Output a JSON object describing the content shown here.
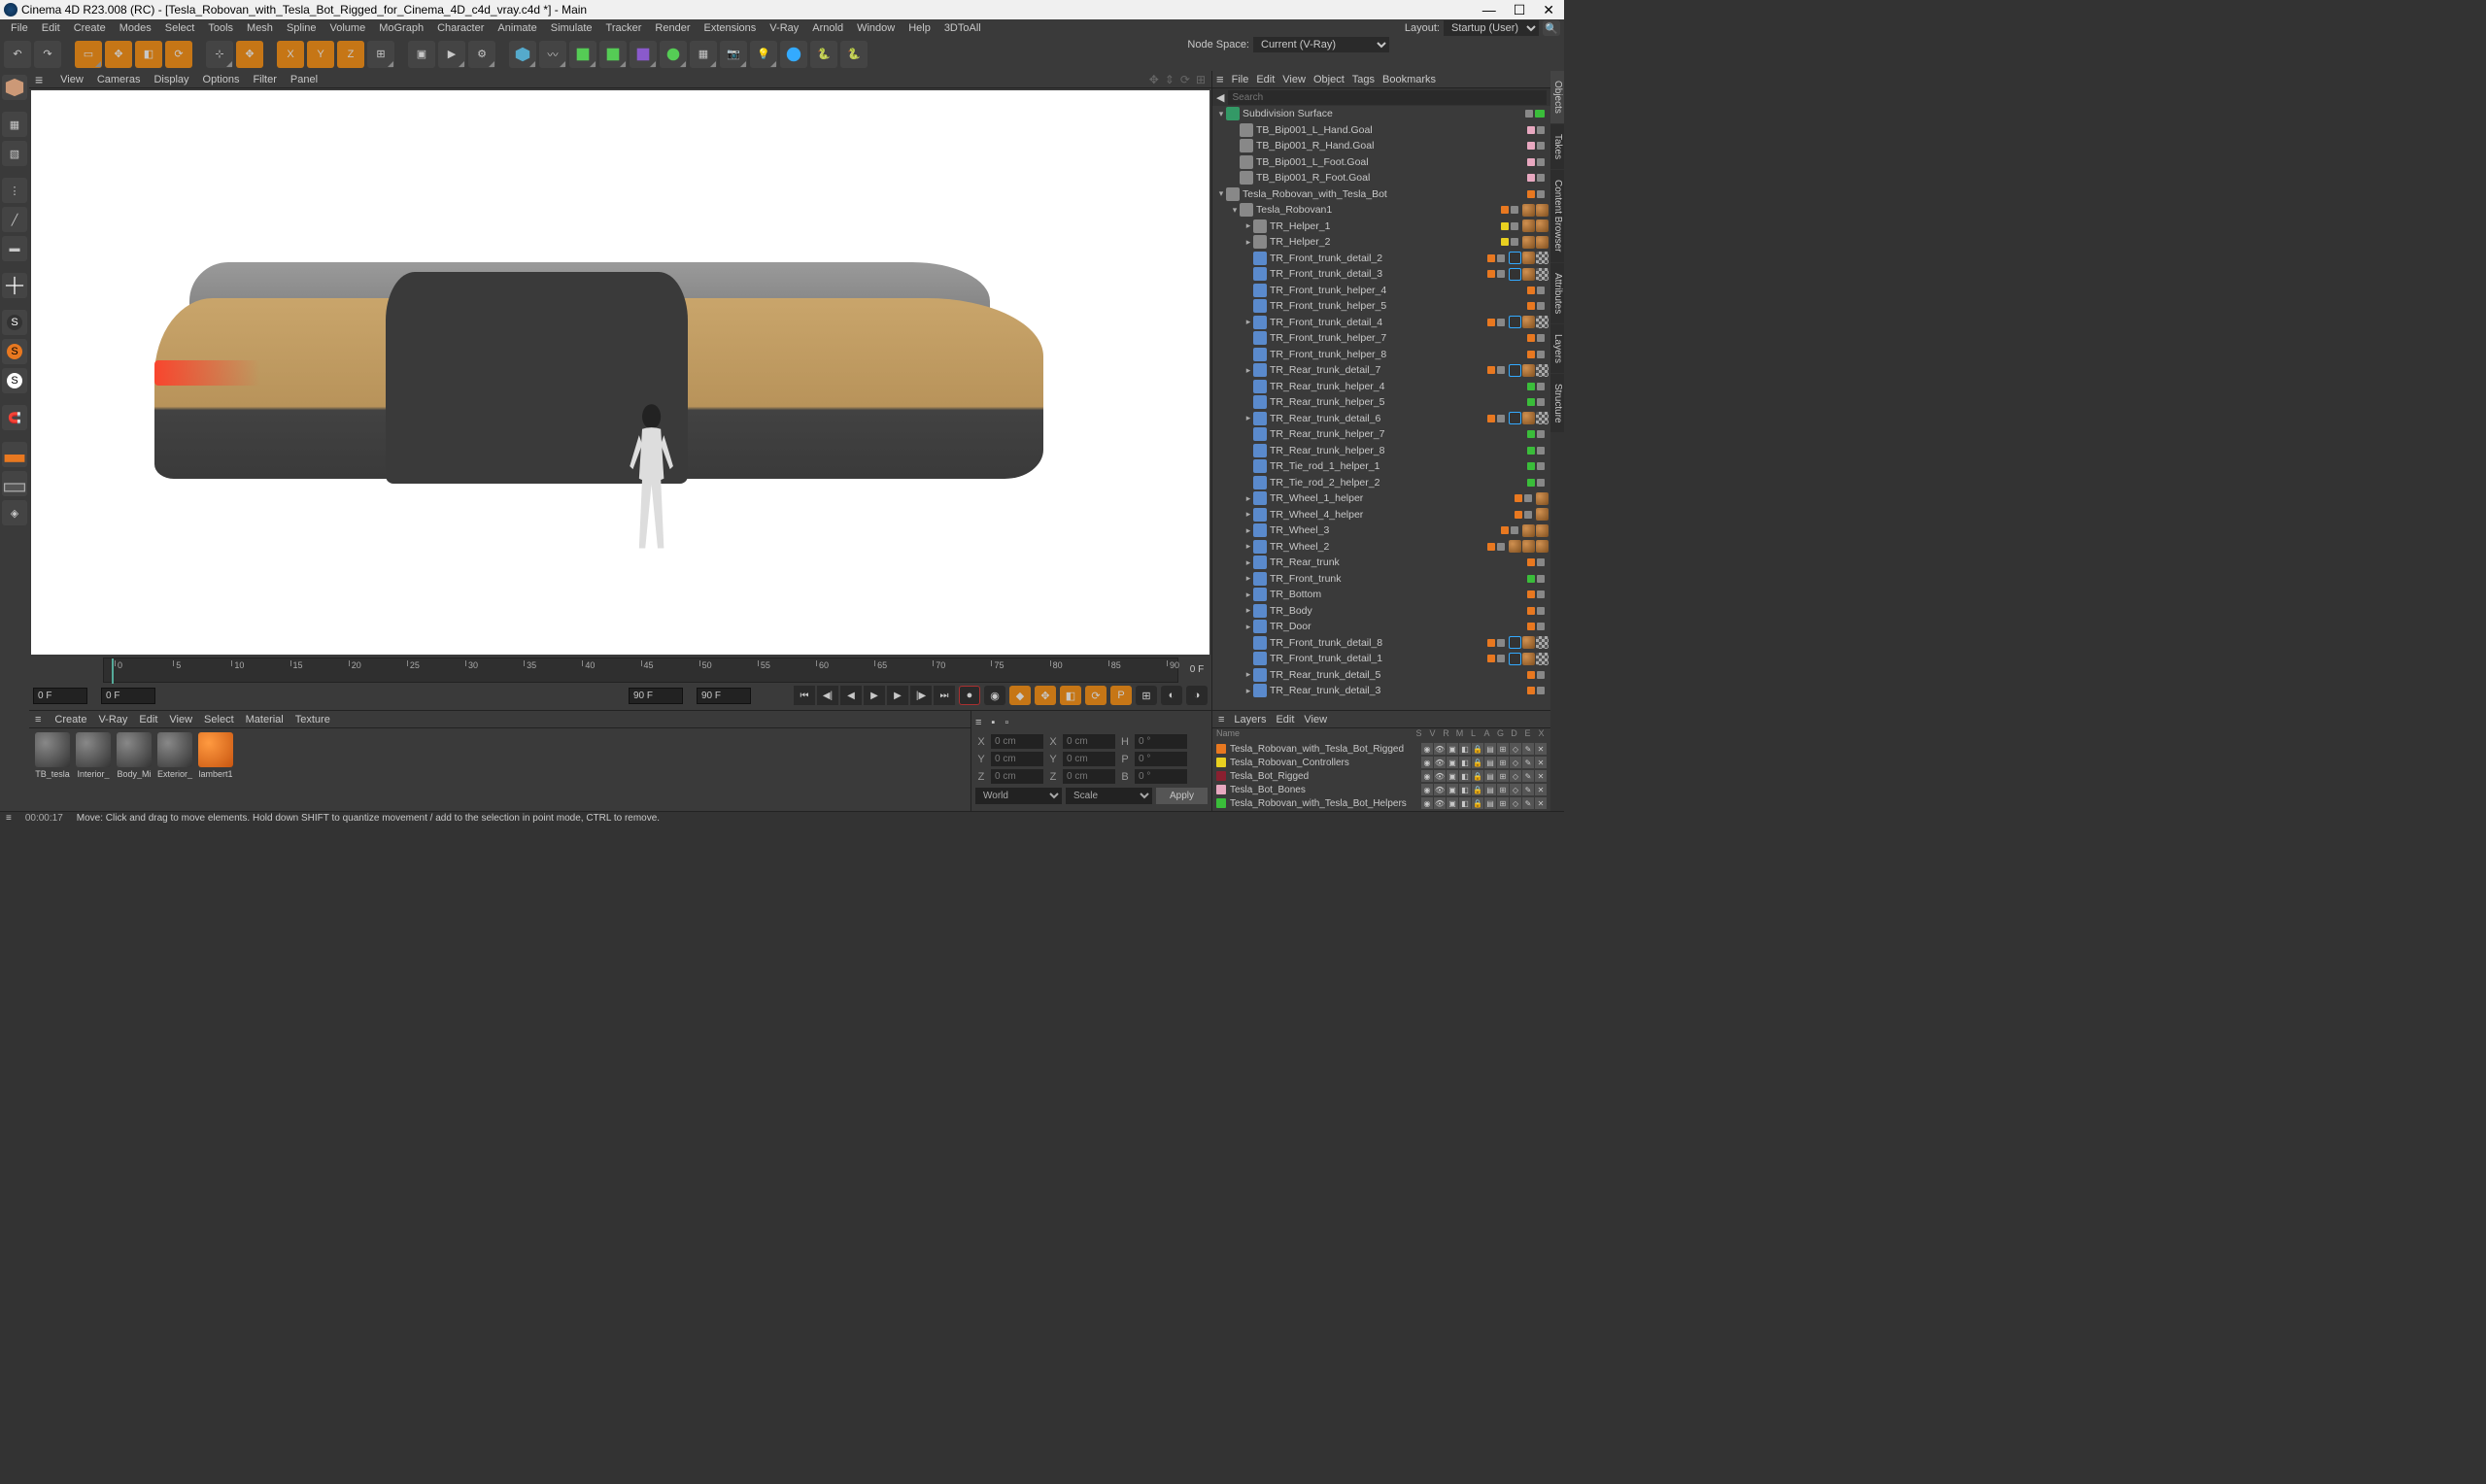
{
  "title": "Cinema 4D R23.008 (RC) - [Tesla_Robovan_with_Tesla_Bot_Rigged_for_Cinema_4D_c4d_vray.c4d *] - Main",
  "menubar": [
    "File",
    "Edit",
    "Create",
    "Modes",
    "Select",
    "Tools",
    "Mesh",
    "Spline",
    "Volume",
    "MoGraph",
    "Character",
    "Animate",
    "Simulate",
    "Tracker",
    "Render",
    "Extensions",
    "V-Ray",
    "Arnold",
    "Window",
    "Help",
    "3DToAll"
  ],
  "layout_label": "Layout:",
  "layout_value": "Startup (User)",
  "node_space_label": "Node Space:",
  "node_space_value": "Current (V-Ray)",
  "viewport_menu": [
    "View",
    "Cameras",
    "Display",
    "Options",
    "Filter",
    "Panel"
  ],
  "timeline": {
    "ticks": [
      "0",
      "5",
      "10",
      "15",
      "20",
      "25",
      "30",
      "35",
      "40",
      "45",
      "50",
      "55",
      "60",
      "65",
      "70",
      "75",
      "80",
      "85",
      "90"
    ],
    "start": "0 F",
    "current": "0 F",
    "end": "90 F",
    "end2": "90 F",
    "badge": "0 F"
  },
  "material_menu": [
    "Create",
    "V-Ray",
    "Edit",
    "View",
    "Select",
    "Material",
    "Texture"
  ],
  "materials": [
    {
      "name": "TB_tesla",
      "cls": ""
    },
    {
      "name": "Interior_",
      "cls": ""
    },
    {
      "name": "Body_Mi",
      "cls": ""
    },
    {
      "name": "Exterior_",
      "cls": ""
    },
    {
      "name": "lambert1",
      "cls": "orange"
    }
  ],
  "coords": {
    "X": "X",
    "Y": "Y",
    "Z": "Z",
    "valX": "0 cm",
    "valY": "0 cm",
    "valZ": "0 cm",
    "s_X": "X",
    "s_valX": "0 cm",
    "s_Y": "Y",
    "s_valY": "0 cm",
    "s_Z": "Z",
    "s_valZ": "0 cm",
    "H": "H",
    "valH": "0 °",
    "P": "P",
    "valP": "0 °",
    "B": "B",
    "valB": "0 °",
    "world": "World",
    "scale": "Scale",
    "apply": "Apply"
  },
  "obj_menu": [
    "File",
    "Edit",
    "View",
    "Object",
    "Tags",
    "Bookmarks"
  ],
  "search_placeholder": "Search",
  "tree": [
    {
      "d": 0,
      "e": "-",
      "ic": "subdiv",
      "l": "Subdivision Surface",
      "dots": [
        "gray",
        "check"
      ],
      "tags": []
    },
    {
      "d": 1,
      "e": "",
      "ic": "null",
      "l": "TB_Bip001_L_Hand.Goal",
      "dots": [
        "pink",
        "gray"
      ],
      "tags": []
    },
    {
      "d": 1,
      "e": "",
      "ic": "null",
      "l": "TB_Bip001_R_Hand.Goal",
      "dots": [
        "pink",
        "gray"
      ],
      "tags": []
    },
    {
      "d": 1,
      "e": "",
      "ic": "null",
      "l": "TB_Bip001_L_Foot.Goal",
      "dots": [
        "pink",
        "gray"
      ],
      "tags": []
    },
    {
      "d": 1,
      "e": "",
      "ic": "null",
      "l": "TB_Bip001_R_Foot.Goal",
      "dots": [
        "pink",
        "gray"
      ],
      "tags": []
    },
    {
      "d": 0,
      "e": "-",
      "ic": "null",
      "l": "Tesla_Robovan_with_Tesla_Bot",
      "dots": [
        "orange",
        "gray"
      ],
      "tags": []
    },
    {
      "d": 1,
      "e": "-",
      "ic": "null",
      "l": "Tesla_Robovan1",
      "dots": [
        "orange",
        "gray"
      ],
      "tags": [
        "mat",
        "mat"
      ]
    },
    {
      "d": 2,
      "e": "+",
      "ic": "null",
      "l": "TR_Helper_1",
      "dots": [
        "yellow",
        "gray"
      ],
      "tags": [
        "mat",
        "mat"
      ]
    },
    {
      "d": 2,
      "e": "+",
      "ic": "null",
      "l": "TR_Helper_2",
      "dots": [
        "yellow",
        "gray"
      ],
      "tags": [
        "mat",
        "mat"
      ]
    },
    {
      "d": 2,
      "e": "",
      "ic": "poly",
      "l": "TR_Front_trunk_detail_2",
      "dots": [
        "orange",
        "gray"
      ],
      "tags": [
        "vray",
        "mat",
        "checker"
      ]
    },
    {
      "d": 2,
      "e": "",
      "ic": "poly",
      "l": "TR_Front_trunk_detail_3",
      "dots": [
        "orange",
        "gray"
      ],
      "tags": [
        "vray",
        "mat",
        "checker"
      ]
    },
    {
      "d": 2,
      "e": "",
      "ic": "poly",
      "l": "TR_Front_trunk_helper_4",
      "dots": [
        "orange",
        "gray"
      ],
      "tags": []
    },
    {
      "d": 2,
      "e": "",
      "ic": "poly",
      "l": "TR_Front_trunk_helper_5",
      "dots": [
        "orange",
        "gray"
      ],
      "tags": []
    },
    {
      "d": 2,
      "e": "+",
      "ic": "poly",
      "l": "TR_Front_trunk_detail_4",
      "dots": [
        "orange",
        "gray"
      ],
      "tags": [
        "vray",
        "mat",
        "checker"
      ]
    },
    {
      "d": 2,
      "e": "",
      "ic": "poly",
      "l": "TR_Front_trunk_helper_7",
      "dots": [
        "orange",
        "gray"
      ],
      "tags": []
    },
    {
      "d": 2,
      "e": "",
      "ic": "poly",
      "l": "TR_Front_trunk_helper_8",
      "dots": [
        "orange",
        "gray"
      ],
      "tags": []
    },
    {
      "d": 2,
      "e": "+",
      "ic": "poly",
      "l": "TR_Rear_trunk_detail_7",
      "dots": [
        "orange",
        "gray"
      ],
      "tags": [
        "vray",
        "mat",
        "checker"
      ]
    },
    {
      "d": 2,
      "e": "",
      "ic": "poly",
      "l": "TR_Rear_trunk_helper_4",
      "dots": [
        "green",
        "gray"
      ],
      "tags": []
    },
    {
      "d": 2,
      "e": "",
      "ic": "poly",
      "l": "TR_Rear_trunk_helper_5",
      "dots": [
        "green",
        "gray"
      ],
      "tags": []
    },
    {
      "d": 2,
      "e": "+",
      "ic": "poly",
      "l": "TR_Rear_trunk_detail_6",
      "dots": [
        "orange",
        "gray"
      ],
      "tags": [
        "vray",
        "mat",
        "checker"
      ]
    },
    {
      "d": 2,
      "e": "",
      "ic": "poly",
      "l": "TR_Rear_trunk_helper_7",
      "dots": [
        "green",
        "gray"
      ],
      "tags": []
    },
    {
      "d": 2,
      "e": "",
      "ic": "poly",
      "l": "TR_Rear_trunk_helper_8",
      "dots": [
        "green",
        "gray"
      ],
      "tags": []
    },
    {
      "d": 2,
      "e": "",
      "ic": "poly",
      "l": "TR_Tie_rod_1_helper_1",
      "dots": [
        "green",
        "gray"
      ],
      "tags": []
    },
    {
      "d": 2,
      "e": "",
      "ic": "poly",
      "l": "TR_Tie_rod_2_helper_2",
      "dots": [
        "green",
        "gray"
      ],
      "tags": []
    },
    {
      "d": 2,
      "e": "+",
      "ic": "poly",
      "l": "TR_Wheel_1_helper",
      "dots": [
        "orange",
        "gray"
      ],
      "tags": [
        "mat"
      ]
    },
    {
      "d": 2,
      "e": "+",
      "ic": "poly",
      "l": "TR_Wheel_4_helper",
      "dots": [
        "orange",
        "gray"
      ],
      "tags": [
        "mat"
      ]
    },
    {
      "d": 2,
      "e": "+",
      "ic": "poly",
      "l": "TR_Wheel_3",
      "dots": [
        "orange",
        "gray"
      ],
      "tags": [
        "mat",
        "mat"
      ]
    },
    {
      "d": 2,
      "e": "+",
      "ic": "poly",
      "l": "TR_Wheel_2",
      "dots": [
        "orange",
        "gray"
      ],
      "tags": [
        "mat",
        "mat",
        "mat"
      ]
    },
    {
      "d": 2,
      "e": "+",
      "ic": "poly",
      "l": "TR_Rear_trunk",
      "dots": [
        "orange",
        "gray"
      ],
      "tags": []
    },
    {
      "d": 2,
      "e": "+",
      "ic": "poly",
      "l": "TR_Front_trunk",
      "dots": [
        "green",
        "gray"
      ],
      "tags": []
    },
    {
      "d": 2,
      "e": "+",
      "ic": "poly",
      "l": "TR_Bottom",
      "dots": [
        "orange",
        "gray"
      ],
      "tags": []
    },
    {
      "d": 2,
      "e": "+",
      "ic": "poly",
      "l": "TR_Body",
      "dots": [
        "orange",
        "gray"
      ],
      "tags": []
    },
    {
      "d": 2,
      "e": "+",
      "ic": "poly",
      "l": "TR_Door",
      "dots": [
        "orange",
        "gray"
      ],
      "tags": []
    },
    {
      "d": 2,
      "e": "",
      "ic": "poly",
      "l": "TR_Front_trunk_detail_8",
      "dots": [
        "orange",
        "gray"
      ],
      "tags": [
        "vray",
        "mat",
        "checker"
      ]
    },
    {
      "d": 2,
      "e": "",
      "ic": "poly",
      "l": "TR_Front_trunk_detail_1",
      "dots": [
        "orange",
        "gray"
      ],
      "tags": [
        "vray",
        "mat",
        "checker"
      ]
    },
    {
      "d": 2,
      "e": "+",
      "ic": "poly",
      "l": "TR_Rear_trunk_detail_5",
      "dots": [
        "orange",
        "gray"
      ],
      "tags": []
    },
    {
      "d": 2,
      "e": "+",
      "ic": "poly",
      "l": "TR_Rear_trunk_detail_3",
      "dots": [
        "orange",
        "gray"
      ],
      "tags": []
    }
  ],
  "layers_menu": [
    "Layers",
    "Edit",
    "View"
  ],
  "layer_header": {
    "name": "Name",
    "flags": [
      "S",
      "V",
      "R",
      "M",
      "L",
      "A",
      "G",
      "D",
      "E",
      "X"
    ]
  },
  "layers": [
    {
      "c": "#e87820",
      "l": "Tesla_Robovan_with_Tesla_Bot_Rigged"
    },
    {
      "c": "#e8d020",
      "l": "Tesla_Robovan_Controllers"
    },
    {
      "c": "#8a2030",
      "l": "Tesla_Bot_Rigged"
    },
    {
      "c": "#e8a8c0",
      "l": "Tesla_Bot_Bones"
    },
    {
      "c": "#3abd3a",
      "l": "Tesla_Robovan_with_Tesla_Bot_Helpers"
    }
  ],
  "right_tabs": [
    "Objects",
    "Takes",
    "Content Browser",
    "",
    "Attributes",
    "Layers",
    "Structure"
  ],
  "status": {
    "time": "00:00:17",
    "hint": "Move: Click and drag to move elements. Hold down SHIFT to quantize movement / add to the selection in point mode, CTRL to remove."
  }
}
